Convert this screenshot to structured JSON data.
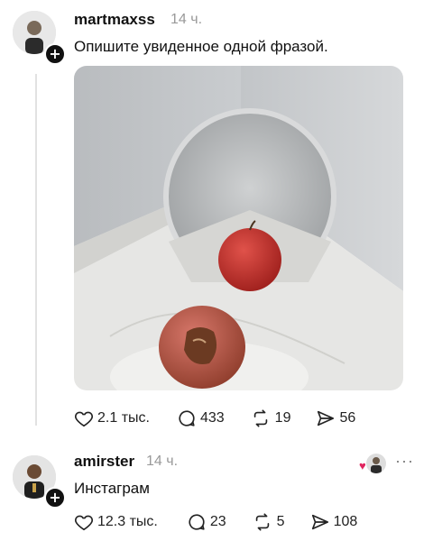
{
  "post": {
    "username": "martmaxss",
    "time": "14 ч.",
    "text": "Опишите увиденное одной фразой.",
    "likes": "2.1 тыс.",
    "comments": "433",
    "reposts": "19",
    "shares": "56"
  },
  "reply": {
    "username": "amirster",
    "time": "14 ч.",
    "text": "Инстаграм",
    "likes": "12.3 тыс.",
    "comments": "23",
    "reposts": "5",
    "shares": "108",
    "more": "···"
  },
  "icons": {
    "follow": "+",
    "like": "heart-icon",
    "comment": "comment-bubble-icon",
    "repost": "repost-icon",
    "share": "send-icon"
  }
}
